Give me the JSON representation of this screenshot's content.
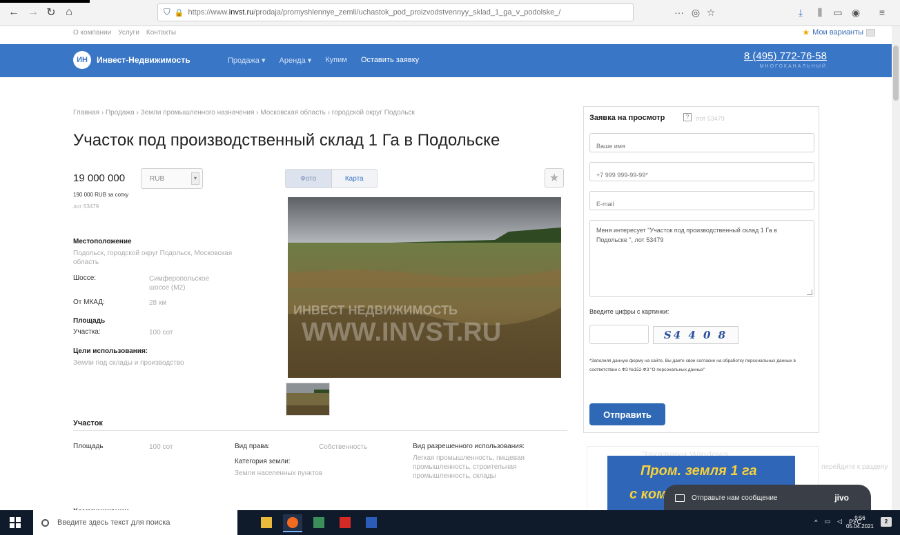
{
  "browser": {
    "url_prefix": "https://www.",
    "url_domain": "invst.ru",
    "url_path": "/prodaja/promyshlennye_zemli/uchastok_pod_proizvodstvennyy_sklad_1_ga_v_podolske_/"
  },
  "toplinks": [
    "О компании",
    "Услуги",
    "Контакты"
  ],
  "favorites_label": "Мои варианты",
  "nav": {
    "logo": "ИН",
    "brand": "Инвест-Недвижимость",
    "items": [
      "Продажа ▾",
      "Аренда ▾",
      "Купим"
    ],
    "cta": "Оставить заявку",
    "phone": "8 (495) 772-76-58",
    "phone_sub": "МНОГОКАНАЛЬНЫЙ"
  },
  "breadcrumb": "Главная › Продажа › Земли промышленного назначения › Московская область › городской округ Подольск",
  "title": "Участок под производственный склад 1 Га в Подольске",
  "price": {
    "value": "19 000 000",
    "currency": "RUB",
    "per_unit": "190 000 RUB за сотку",
    "lot": "лот 53479"
  },
  "location": {
    "heading": "Местоположение",
    "text": "Подольск, городской округ Подольск, Московская область",
    "highway_label": "Шоссе:",
    "highway_value": "Симферопольское шоссе (М2)",
    "mkad_label": "От МКАД:",
    "mkad_value": "28 км"
  },
  "area": {
    "heading": "Площадь",
    "label": "Участка:",
    "value": "100 сот"
  },
  "purpose": {
    "heading": "Цели использования:",
    "value": "Земли под склады и производство"
  },
  "tabs": {
    "photo": "Фото",
    "map": "Карта"
  },
  "watermark": {
    "line1": "ИНВЕСТ НЕДВИЖИМОСТЬ",
    "line2": "WWW.INVST.RU"
  },
  "plot": {
    "heading": "Участок",
    "area_label": "Площадь",
    "area_value": "100 сот",
    "right_label": "Вид права:",
    "right_value": "Собственность",
    "category_label": "Категория земли:",
    "category_value": "Земли населенных пунктов",
    "permitted_label": "Вид разрешенного использования:",
    "permitted_value": "Легкая промышленность, пищевая промышленность, строительная промышленность, склады"
  },
  "form": {
    "heading": "Заявка на просмотр",
    "sub": "лот 53479",
    "name_placeholder": "Ваше имя",
    "phone_placeholder": "+7 999 999-99-99*",
    "email_placeholder": "E-mail",
    "message": "Меня интересует \"Участок под производственный склад 1 Га в Подольске \", лот 53479",
    "captcha_label": "Введите цифры с картинки:",
    "captcha_text": "S4 4 0 8",
    "consent": "*Заполняя данную форму на сайте, Вы даете свое согласие на обработку персональных данных в соответствии с ФЗ №152-ФЗ \"О персональных данных\"",
    "submit": "Отправить"
  },
  "banner": {
    "ghost_text": "Заказчики Windows",
    "ghost_text2": "перейдите к разделу",
    "line1": "Пром. земля 1 га",
    "line2": "с ком"
  },
  "chat": {
    "text": "Отправьте нам сообщение",
    "brand": "jivo"
  },
  "bottom_heading": "Коммуникации",
  "taskbar": {
    "search_placeholder": "Введите здесь текст для поиска",
    "lang": "РУС",
    "time": "9:56",
    "date": "05.04.2021",
    "notifications": "2"
  }
}
